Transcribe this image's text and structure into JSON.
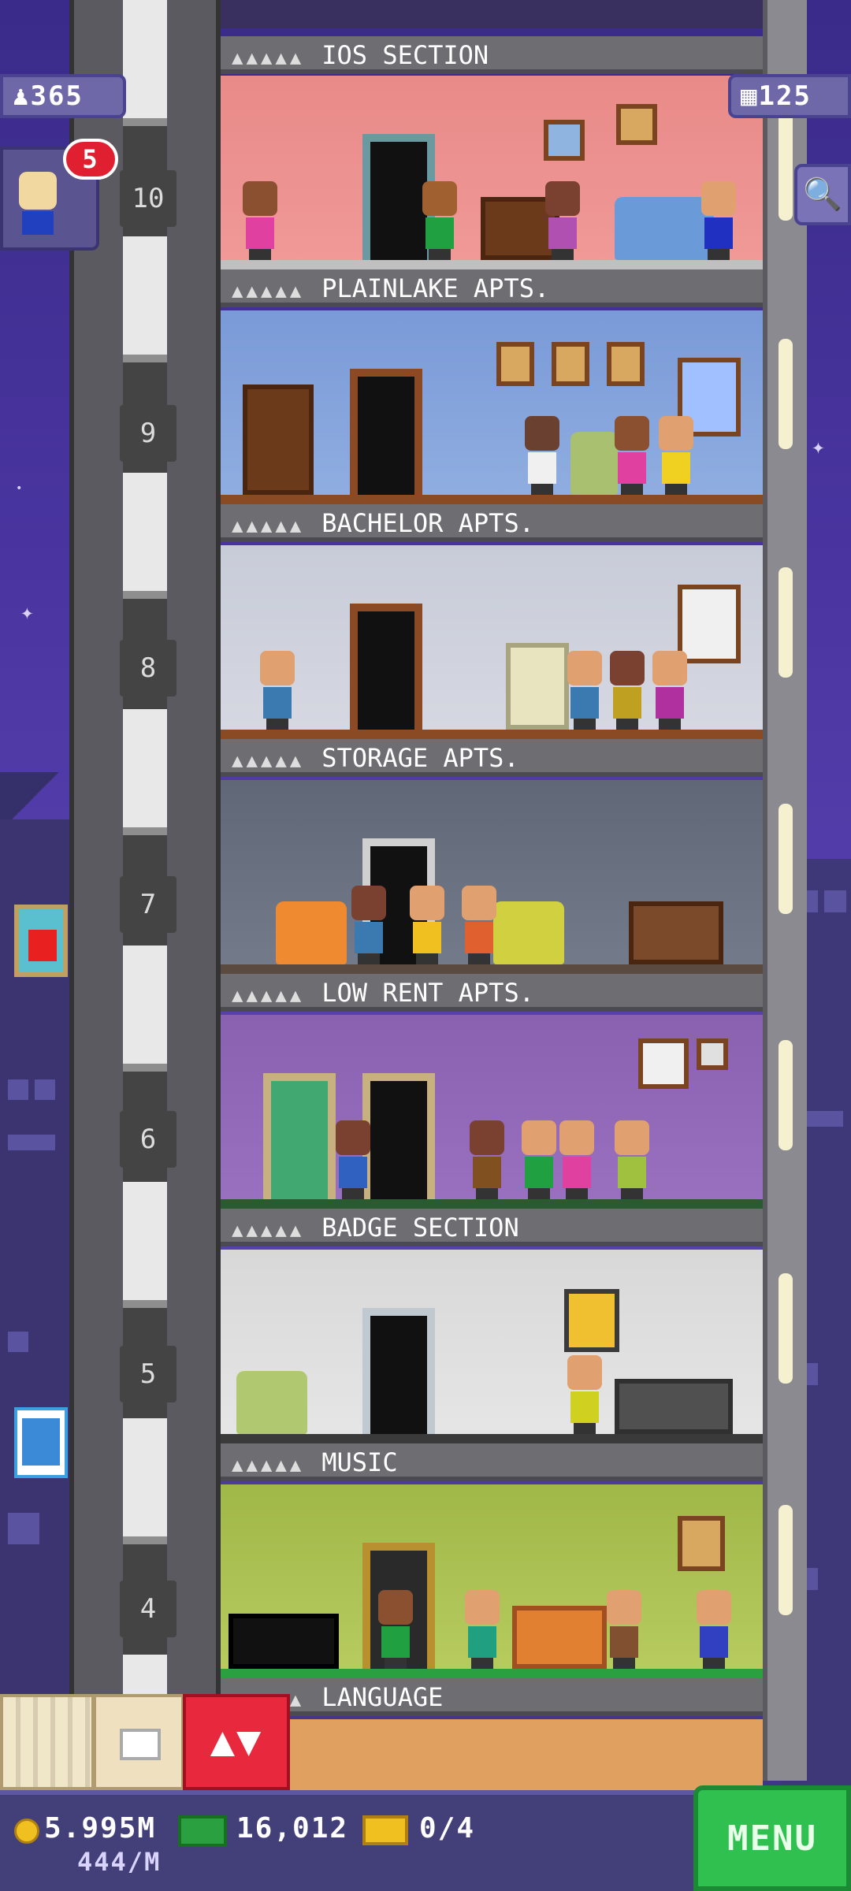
{
  "hud": {
    "population": "365",
    "floors_count": "125",
    "visitor_badge": "5"
  },
  "floors": [
    {
      "number": "",
      "label": "IOS SECTION"
    },
    {
      "number": "10",
      "label": "PLAINLAKE APTS."
    },
    {
      "number": "9",
      "label": "BACHELOR APTS."
    },
    {
      "number": "8",
      "label": "STORAGE APTS."
    },
    {
      "number": "7",
      "label": "LOW RENT APTS."
    },
    {
      "number": "6",
      "label": "BADGE SECTION"
    },
    {
      "number": "5",
      "label": "MUSIC"
    },
    {
      "number": "4",
      "label": "LANGUAGE"
    }
  ],
  "resources": {
    "coins": "5.995M",
    "coins_rate": "444/M",
    "bux": "16,012",
    "tickets": "0/4"
  },
  "buttons": {
    "menu": "MENU",
    "elevator": "▲▼"
  },
  "icons": {
    "search": "🔍",
    "population": "person-icon",
    "floors": "building-icon"
  },
  "colors": {
    "menu_green": "#2fc050",
    "elevator_red": "#e8283c",
    "sky": "#4a35a0"
  }
}
